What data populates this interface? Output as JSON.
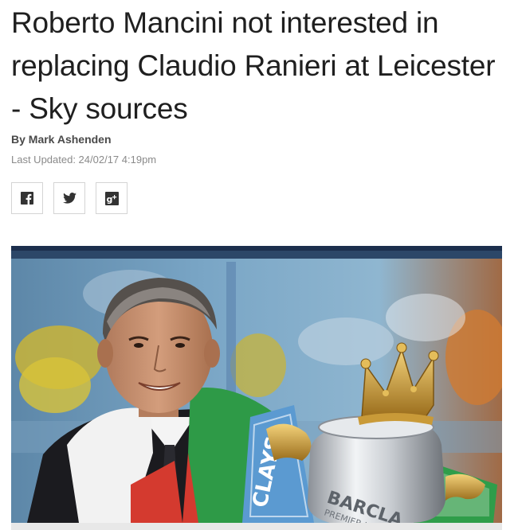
{
  "article": {
    "headline": "Roberto Mancini not interested in replacing Claudio Ranieri at Leicester - Sky sources",
    "byline": "By Mark Ashenden",
    "last_updated": "Last Updated: 24/02/17 4:19pm"
  },
  "share": {
    "facebook_icon": "facebook-icon",
    "twitter_icon": "twitter-icon",
    "googleplus_icon": "google-plus-icon"
  },
  "image": {
    "subject": "man-holding-trophy",
    "trophy_text_1": "CLAYS",
    "trophy_text_2": "BARCLA",
    "trophy_text_3": "PREMIER LE"
  },
  "colors": {
    "headline": "#1f1f1f",
    "byline": "#4a4a4a",
    "muted": "#8a8a8a",
    "border": "#d4d4d4"
  }
}
